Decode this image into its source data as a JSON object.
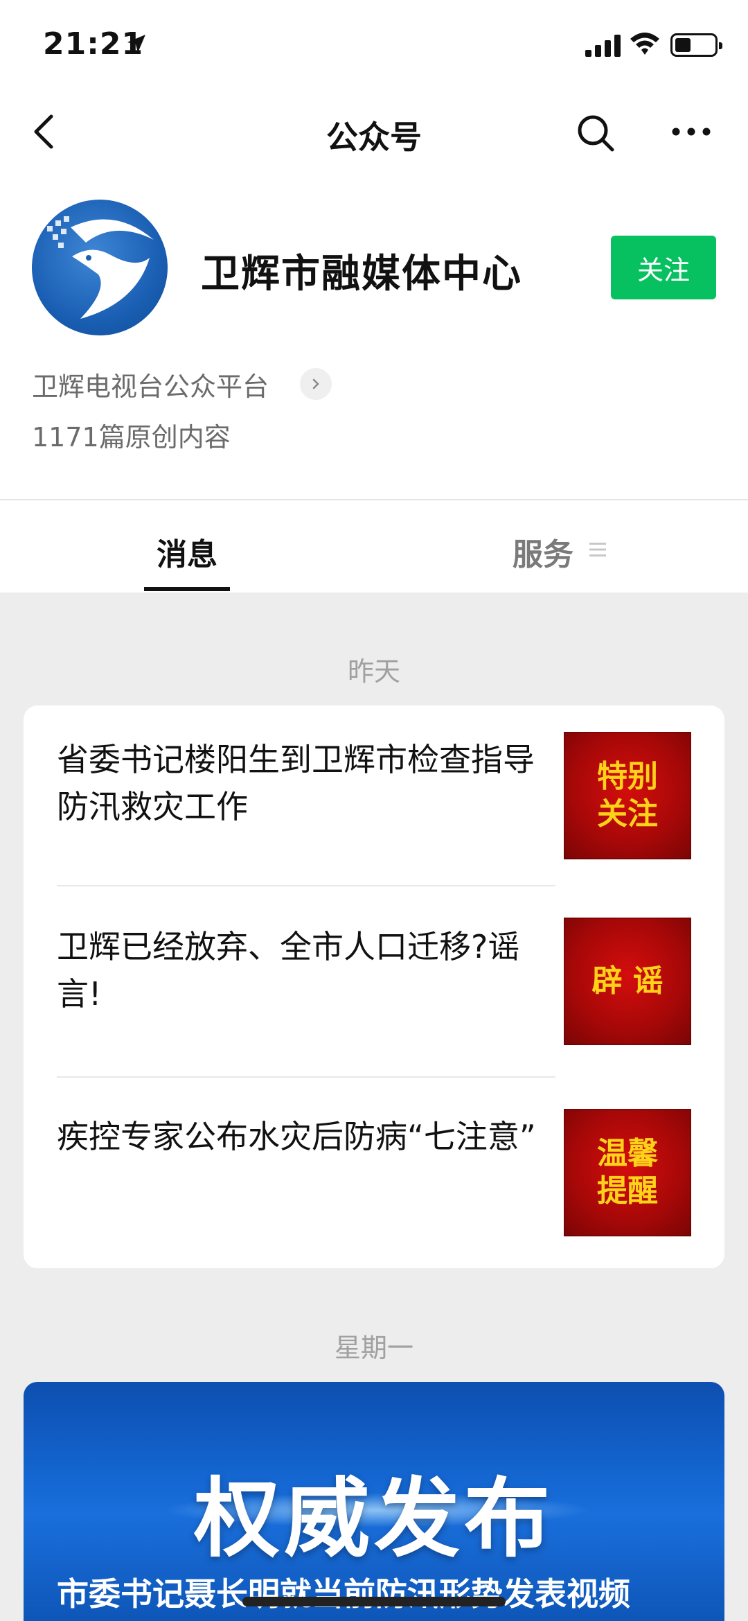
{
  "status_bar": {
    "time": "21:21"
  },
  "nav": {
    "title": "公众号"
  },
  "account": {
    "name": "卫辉市融媒体中心",
    "follow_label": "关注",
    "description": "卫辉电视台公众平台",
    "original_count": "1171篇原创内容"
  },
  "tabs": [
    {
      "label": "消息",
      "active": true
    },
    {
      "label": "服务",
      "active": false
    }
  ],
  "groups": [
    {
      "date": "昨天",
      "articles": [
        {
          "title": "省委书记楼阳生到卫辉市检查指导防汛救灾工作",
          "thumb_lines": [
            "特别",
            "关注"
          ]
        },
        {
          "title": "卫辉已经放弃、全市人口迁移?谣言!",
          "thumb_lines": [
            "辟 谣"
          ]
        },
        {
          "title": "疾控专家公布水灾后防病“七注意”",
          "thumb_lines": [
            "温馨",
            "提醒"
          ]
        }
      ]
    },
    {
      "date": "星期一",
      "feature": {
        "banner_text": "权威发布",
        "caption": "市委书记聂长明就当前防汛形势发表视频"
      }
    }
  ],
  "colors": {
    "accent": "#07c160",
    "thumb_bg": "#b50909",
    "thumb_text": "#ffd21a",
    "banner_bg": "#1466d1"
  }
}
